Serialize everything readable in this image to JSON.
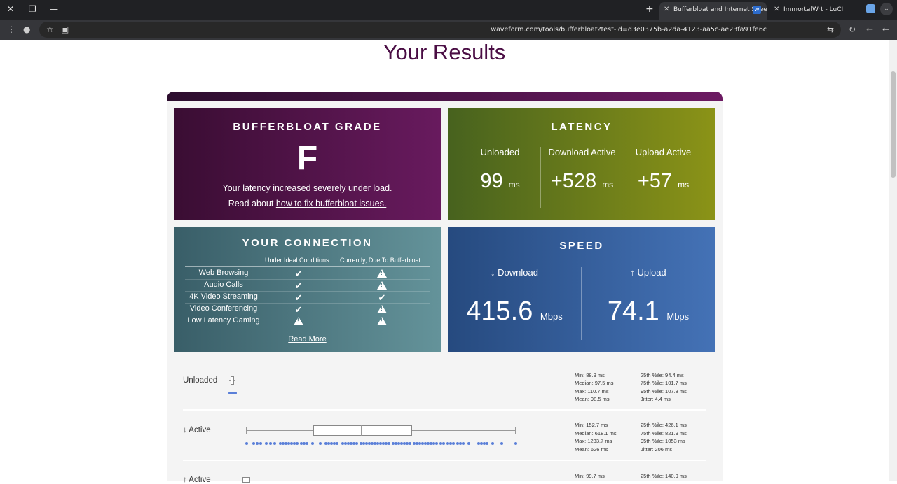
{
  "browser": {
    "tabs": [
      {
        "title": "Bufferbloat and Internet Speed",
        "active": true
      },
      {
        "title": "ImmortalWrt - LuCI",
        "active": false
      }
    ],
    "url": "waveform.com/tools/bufferbloat?test-id=d3e0375b-a2da-4123-aa5c-ae23fa91fe6c",
    "favicon_text": "W"
  },
  "page": {
    "title": "Your Results"
  },
  "grade": {
    "heading": "BUFFERBLOAT GRADE",
    "letter": "F",
    "line1": "Your latency increased severely under load.",
    "line2_prefix": "Read about",
    "link": "how to fix bufferbloat issues."
  },
  "latency": {
    "heading": "LATENCY",
    "unit": "ms",
    "columns": [
      {
        "label": "Unloaded",
        "value": "99"
      },
      {
        "label": "Download Active",
        "value": "+528"
      },
      {
        "label": "Upload Active",
        "value": "+57"
      }
    ]
  },
  "connection": {
    "heading": "YOUR CONNECTION",
    "col_ideal": "Under Ideal Conditions",
    "col_current": "Currently, Due To Bufferbloat",
    "rows": [
      {
        "name": "Web Browsing",
        "ideal": "check",
        "current": "warning"
      },
      {
        "name": "Audio Calls",
        "ideal": "check",
        "current": "warning"
      },
      {
        "name": "4K Video Streaming",
        "ideal": "check",
        "current": "check"
      },
      {
        "name": "Video Conferencing",
        "ideal": "check",
        "current": "warning"
      },
      {
        "name": "Low Latency Gaming",
        "ideal": "warning",
        "current": "warning"
      }
    ],
    "read_more": "Read More"
  },
  "speed": {
    "heading": "SPEED",
    "unit": "Mbps",
    "download": {
      "label": "↓ Download",
      "value": "415.6"
    },
    "upload": {
      "label": "↑ Upload",
      "value": "74.1"
    }
  },
  "stats": [
    {
      "label": "Unloaded",
      "left": [
        "Min: 88.9 ms",
        "Median: 97.5 ms",
        "Max: 110.7 ms",
        "Mean: 98.5 ms"
      ],
      "right": [
        "25th %ile: 94.4 ms",
        "75th %ile: 101.7 ms",
        "95th %ile: 107.8 ms",
        "Jitter: 4.4 ms"
      ]
    },
    {
      "label": "↓ Active",
      "left": [
        "Min: 152.7 ms",
        "Median: 618.1 ms",
        "Max: 1233.7 ms",
        "Mean: 626 ms"
      ],
      "right": [
        "25th %ile: 426.1 ms",
        "75th %ile: 821.9 ms",
        "95th %ile: 1053 ms",
        "Jitter: 206 ms"
      ]
    },
    {
      "label": "↑ Active",
      "left": [
        "Min: 99.7 ms"
      ],
      "right": [
        "25th %ile: 140.9 ms"
      ]
    }
  ]
}
